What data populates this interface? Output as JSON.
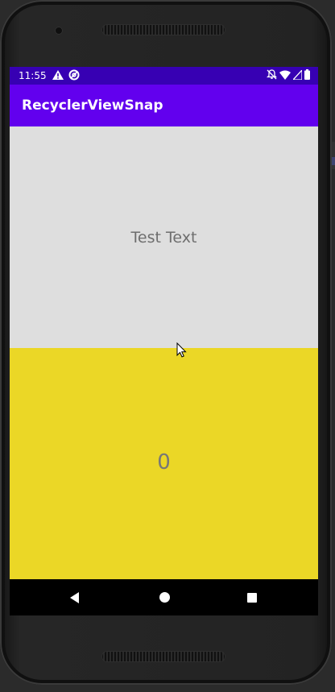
{
  "status_bar": {
    "time": "11:55",
    "left_icons": [
      "warning-icon",
      "sync-icon"
    ],
    "right_icons": [
      "notifications-off-icon",
      "wifi-icon",
      "signal-icon",
      "battery-icon"
    ],
    "color": "#3700b3"
  },
  "app_bar": {
    "title": "RecyclerViewSnap",
    "color": "#6200ee"
  },
  "list": {
    "items": [
      {
        "text": "Test Text",
        "background": "#dedede"
      },
      {
        "text": "0",
        "background": "#ebd726"
      }
    ]
  },
  "nav_bar": {
    "buttons": [
      "back-icon",
      "home-icon",
      "recents-icon"
    ]
  }
}
